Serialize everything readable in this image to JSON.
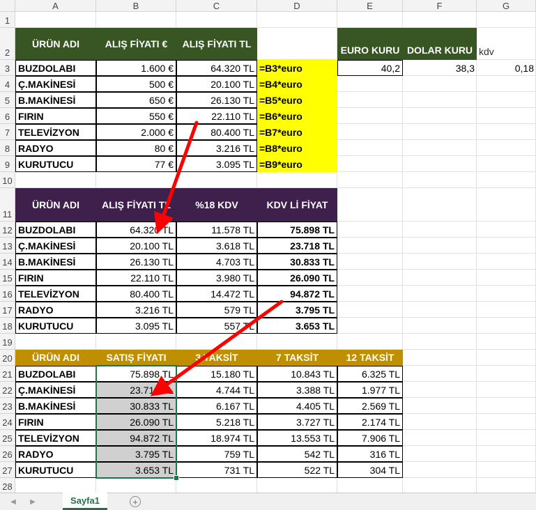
{
  "columns": [
    "A",
    "B",
    "C",
    "D",
    "E",
    "F",
    "G"
  ],
  "rows": [
    "1",
    "2",
    "3",
    "4",
    "5",
    "6",
    "7",
    "8",
    "9",
    "10",
    "11",
    "12",
    "13",
    "14",
    "15",
    "16",
    "17",
    "18",
    "19",
    "20",
    "21",
    "22",
    "23",
    "24",
    "25",
    "26",
    "27",
    "28"
  ],
  "table1": {
    "headers": [
      "ÜRÜN ADI",
      "ALIŞ FİYATI €",
      "ALIŞ FİYATI TL"
    ],
    "rows": [
      {
        "name": "BUZDOLABI",
        "eur": "1.600 €",
        "tl": "64.320 TL",
        "formula": "=B3*euro"
      },
      {
        "name": "Ç.MAKİNESİ",
        "eur": "500 €",
        "tl": "20.100 TL",
        "formula": "=B4*euro"
      },
      {
        "name": "B.MAKİNESİ",
        "eur": "650 €",
        "tl": "26.130 TL",
        "formula": "=B5*euro"
      },
      {
        "name": "FIRIN",
        "eur": "550 €",
        "tl": "22.110 TL",
        "formula": "=B6*euro"
      },
      {
        "name": "TELEVİZYON",
        "eur": "2.000 €",
        "tl": "80.400 TL",
        "formula": "=B7*euro"
      },
      {
        "name": "RADYO",
        "eur": "80 €",
        "tl": "3.216 TL",
        "formula": "=B8*euro"
      },
      {
        "name": "KURUTUCU",
        "eur": "77 €",
        "tl": "3.095 TL",
        "formula": "=B9*euro"
      }
    ]
  },
  "rates": {
    "euro_label": "EURO KURU",
    "dolar_label": "DOLAR KURU",
    "kdv_label": "kdv",
    "euro_value": "40,2",
    "dolar_value": "38,3",
    "kdv_value": "0,18"
  },
  "table2": {
    "headers": [
      "ÜRÜN ADI",
      "ALIŞ FİYATI TL",
      "%18 KDV",
      "KDV Lİ FİYAT"
    ],
    "rows": [
      {
        "name": "BUZDOLABI",
        "tl": "64.320 TL",
        "kdv": "11.578 TL",
        "total": "75.898 TL"
      },
      {
        "name": "Ç.MAKİNESİ",
        "tl": "20.100 TL",
        "kdv": "3.618 TL",
        "total": "23.718 TL"
      },
      {
        "name": "B.MAKİNESİ",
        "tl": "26.130 TL",
        "kdv": "4.703 TL",
        "total": "30.833 TL"
      },
      {
        "name": "FIRIN",
        "tl": "22.110 TL",
        "kdv": "3.980 TL",
        "total": "26.090 TL"
      },
      {
        "name": "TELEVİZYON",
        "tl": "80.400 TL",
        "kdv": "14.472 TL",
        "total": "94.872 TL"
      },
      {
        "name": "RADYO",
        "tl": "3.216 TL",
        "kdv": "579 TL",
        "total": "3.795 TL"
      },
      {
        "name": "KURUTUCU",
        "tl": "3.095 TL",
        "kdv": "557 TL",
        "total": "3.653 TL"
      }
    ]
  },
  "table3": {
    "headers": [
      "ÜRÜN ADI",
      "SATIŞ FİYATI",
      "3 TAKSİT",
      "7 TAKSİT",
      "12 TAKSİT"
    ],
    "rows": [
      {
        "name": "BUZDOLABI",
        "price": "75.898 TL",
        "t3": "15.180 TL",
        "t7": "10.843 TL",
        "t12": "6.325 TL"
      },
      {
        "name": "Ç.MAKİNESİ",
        "price": "23.718 TL",
        "t3": "4.744 TL",
        "t7": "3.388 TL",
        "t12": "1.977 TL"
      },
      {
        "name": "B.MAKİNESİ",
        "price": "30.833 TL",
        "t3": "6.167 TL",
        "t7": "4.405 TL",
        "t12": "2.569 TL"
      },
      {
        "name": "FIRIN",
        "price": "26.090 TL",
        "t3": "5.218 TL",
        "t7": "3.727 TL",
        "t12": "2.174 TL"
      },
      {
        "name": "TELEVİZYON",
        "price": "94.872 TL",
        "t3": "18.974 TL",
        "t7": "13.553 TL",
        "t12": "7.906 TL"
      },
      {
        "name": "RADYO",
        "price": "3.795 TL",
        "t3": "759 TL",
        "t7": "542 TL",
        "t12": "316 TL"
      },
      {
        "name": "KURUTUCU",
        "price": "3.653 TL",
        "t3": "731 TL",
        "t7": "522 TL",
        "t12": "304 TL"
      }
    ]
  },
  "sheet_tab": "Sayfa1",
  "add_sheet_symbol": "+",
  "nav_prev_symbol": "◀",
  "nav_next_symbol": "▶",
  "colors": {
    "green": "#375623",
    "purple": "#3f1f4b",
    "gold": "#bf8f00",
    "formula_bg": "#ffff00",
    "arrow": "#ff0000",
    "selection": "#217346"
  }
}
